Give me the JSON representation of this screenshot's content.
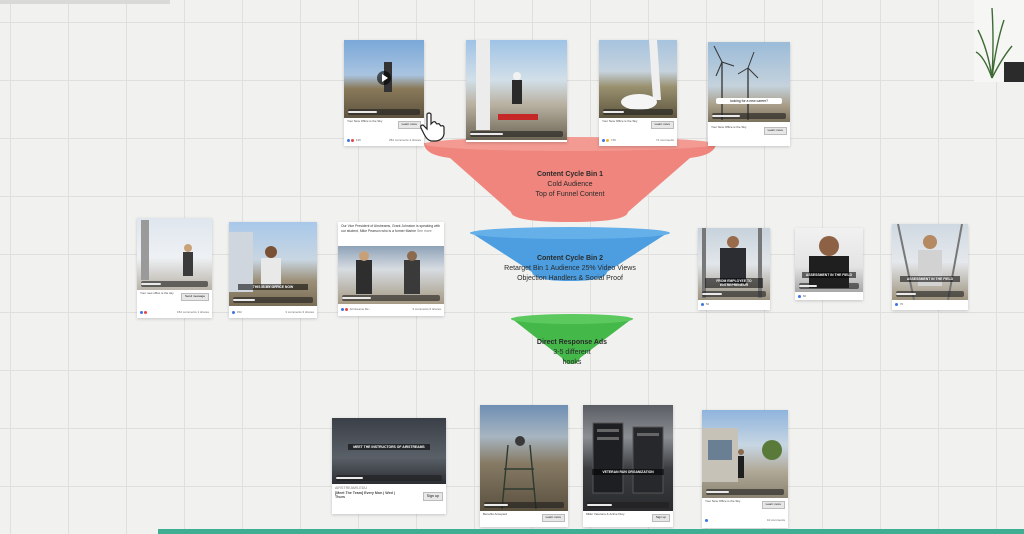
{
  "funnel": {
    "tier1": {
      "title": "Content Cycle Bin 1",
      "line1": "Cold Audience",
      "line2": "Top of Funnel Content",
      "color": "#ef857c"
    },
    "tier2": {
      "title": "Content Cycle Bin 2",
      "line1": "Retarget Bin 1 Audience 25% Video Views",
      "line2": "Objection Handlers & Social Proof",
      "color": "#4c9ee0"
    },
    "tier3": {
      "title": "Direct Response Ads",
      "line1": "3-5 different",
      "line2": "hooks",
      "color": "#45b84a"
    }
  },
  "common": {
    "learn_more": "Learn more",
    "send_message": "Send message",
    "sign_up": "Sign up",
    "page_name": "Your New Office is the Sky",
    "comments": "10 comments",
    "see_more": "See more"
  },
  "top_cards": [
    {
      "caption": "Your New Office is the Sky",
      "reactions": "136",
      "comments": "252 comments  4 shares"
    },
    {
      "caption": "",
      "reactions": "",
      "comments": ""
    },
    {
      "caption": "Your New Office is the Sky",
      "reactions": "746",
      "comments": "71 comments"
    },
    {
      "caption": "Your New Office is the Sky",
      "overlay": "looking for a new career?",
      "reactions": "",
      "comments": ""
    }
  ],
  "mid_left_cards": [
    {
      "caption": "Your new office is the sky",
      "comments": "152 comments  1 shares"
    },
    {
      "overlay": "THIS IS MY OFFICE NOW",
      "reactions": "152",
      "comments": "3 comments  3 shares"
    },
    {
      "text": "Our Vice President of Airstreams, Grant Johnston is speaking with our student, Mike Pearson who is a former Marine",
      "reactions": "Airstreams Re...",
      "comments": "3 comments  6 shares"
    }
  ],
  "mid_right_cards": [
    {
      "overlay": "FROM EMPLOYEE TO ENTREPRENEUR",
      "reactions": "50"
    },
    {
      "overlay": "ASSESSMENT IN THE FIELD",
      "reactions": "82"
    },
    {
      "overlay": "ASSESSMENT IN THE FIELD",
      "reactions": "70"
    }
  ],
  "bottom_cards": [
    {
      "overlay": "MEET THE INSTRUCTORS OF AIRSTREAMS",
      "domain": "AIRSTREAMS.EDU",
      "headline": "[Meet The Team] Every Mon | Wed | Thurs"
    },
    {
      "caption": "Benefits Accepted",
      "overlay": ""
    },
    {
      "caption": "Miller Veterans & Active Duty",
      "overlay": "VETERAN RUN ORGANIZATION"
    },
    {
      "caption": "Your New Office is the Sky",
      "comments": "10 comments"
    }
  ]
}
